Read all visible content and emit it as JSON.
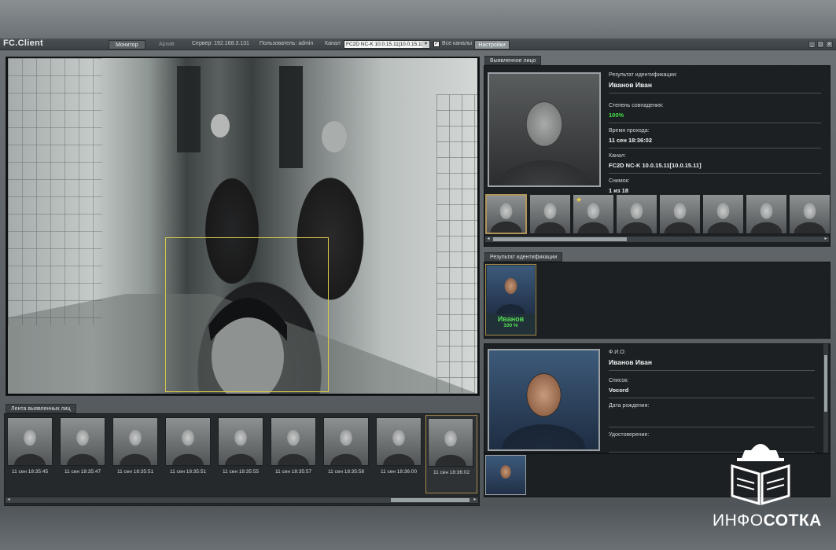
{
  "app": {
    "logo": "FC.Client"
  },
  "topbar": {
    "tab_monitor": "Монитор",
    "tab_archive": "Архив",
    "server_label": "Сервер: 192.168.3.131",
    "users_label": "Пользователь: admin",
    "channel_label": "Канал",
    "channel_value": "FC2D NC-K 10.0.15.11[10.0.15.11]",
    "all_channels_label": "Все каналы",
    "settings_label": "Настройки"
  },
  "feed": {
    "tab_label": "Лента выявленных лиц",
    "items": [
      {
        "time": "11 сен 18:35:45"
      },
      {
        "time": "11 сен 18:35:47"
      },
      {
        "time": "11 сен 18:35:51"
      },
      {
        "time": "11 сен 18:35:51"
      },
      {
        "time": "11 сен 18:35:55"
      },
      {
        "time": "11 сен 18:35:57"
      },
      {
        "time": "11 сен 18:35:58"
      },
      {
        "time": "11 сен 18:36:00"
      },
      {
        "time": "11 сен 18:36:02"
      }
    ],
    "selected_index": 8
  },
  "detected": {
    "tab_label": "Выявленное лицо",
    "result_label": "Результат идентификации:",
    "result_value": "Иванов Иван",
    "match_label": "Степень совпадения:",
    "match_value": "100%",
    "time_label": "Время прохода:",
    "time_value": "11 сен 18:36:02",
    "channel_label": "Канал:",
    "channel_value": "FC2D NC-K 10.0.15.11[10.0.15.11]",
    "snapshot_label": "Снимок:",
    "snapshot_value": "1 из 18",
    "snapshots_starred_index": 2
  },
  "identification": {
    "tab_label": "Результат идентификации",
    "card_name": "Иванов",
    "card_percent": "100 %"
  },
  "profile": {
    "fio_label": "Ф.И.О:",
    "fio_value": "Иванов Иван",
    "list_label": "Список:",
    "list_value": "Vocord",
    "birth_label": "Дата рождения:",
    "birth_value": "",
    "id_label": "Удостоверение:",
    "id_value": ""
  },
  "watermark": {
    "text_light": "ИНФО",
    "text_bold": "СОТКА"
  },
  "colors": {
    "match_green": "#45e04a",
    "face_box": "#d8c94a",
    "selected_border": "#a68a4c"
  }
}
